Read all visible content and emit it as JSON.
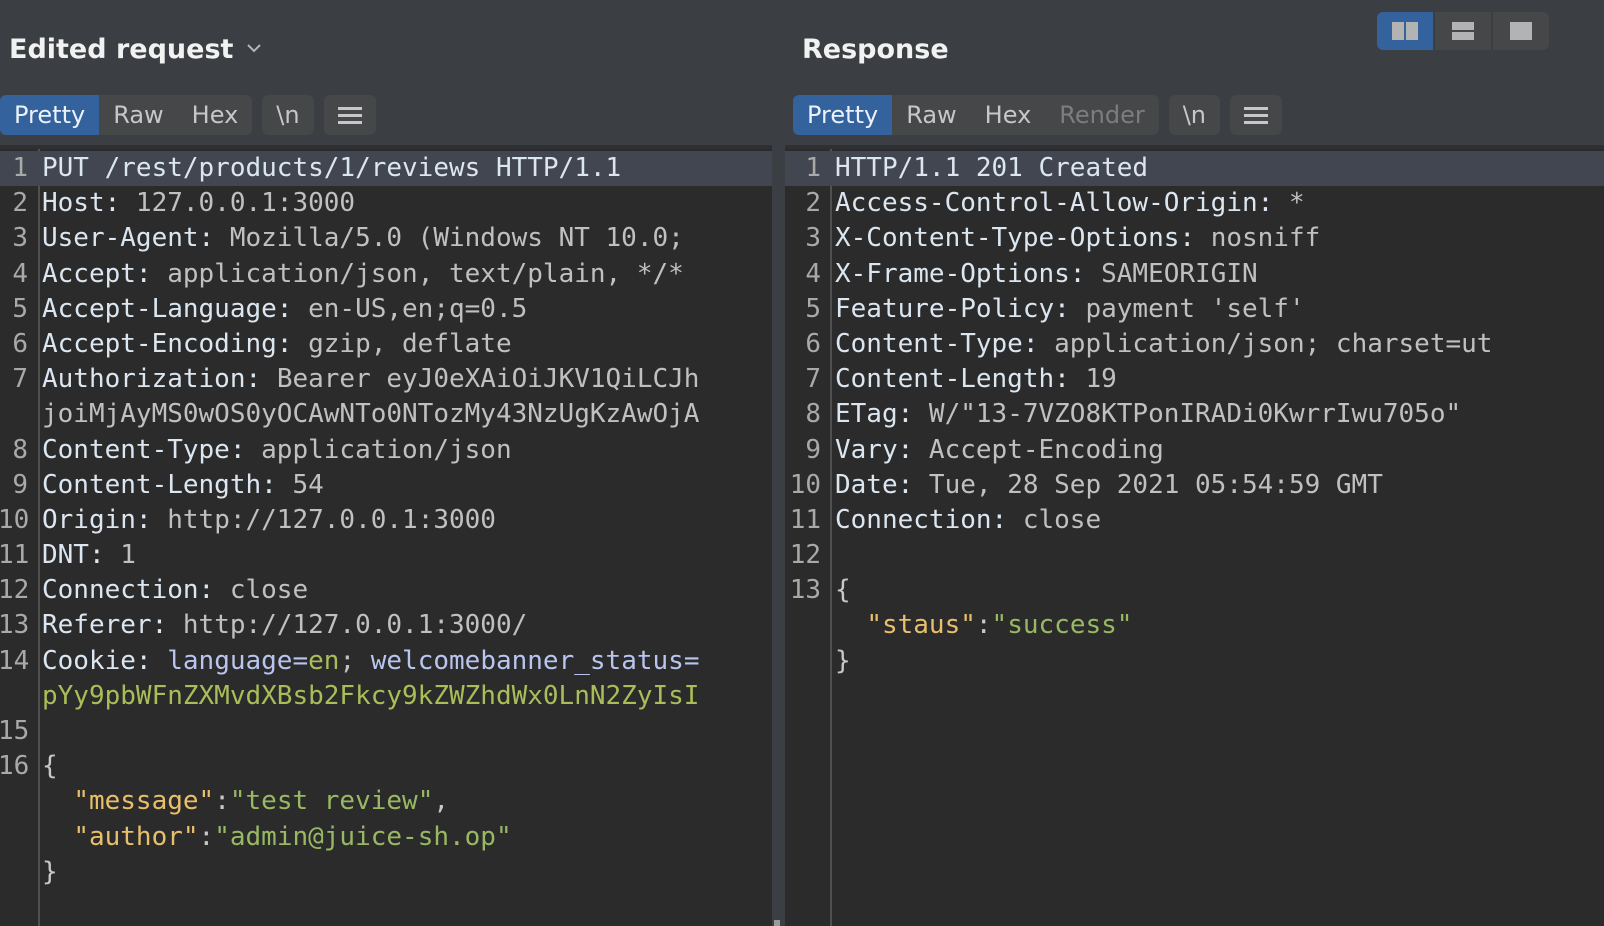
{
  "request": {
    "title": "Edited request",
    "tabs": [
      {
        "label": "Pretty",
        "active": true
      },
      {
        "label": "Raw",
        "active": false
      },
      {
        "label": "Hex",
        "active": false
      }
    ],
    "newline_toggle": "\\n",
    "menu_icon": "hamburger-menu-icon",
    "lines": {
      "l1": {
        "num": "1",
        "text": "PUT /rest/products/1/reviews HTTP/1.1"
      },
      "l2": {
        "num": "2",
        "name": "Host: ",
        "value": "127.0.0.1:3000"
      },
      "l3": {
        "num": "3",
        "name": "User-Agent: ",
        "value": "Mozilla/5.0 (Windows NT 10.0; "
      },
      "l4": {
        "num": "4",
        "name": "Accept: ",
        "value": "application/json, text/plain, */*"
      },
      "l5": {
        "num": "5",
        "name": "Accept-Language: ",
        "value": "en-US,en;q=0.5"
      },
      "l6": {
        "num": "6",
        "name": "Accept-Encoding: ",
        "value": "gzip, deflate"
      },
      "l7": {
        "num": "7",
        "name": "Authorization: ",
        "value": "Bearer eyJ0eXAiOiJKV1QiLCJh",
        "cont": "joiMjAyMS0wOS0yOCAwNTo0NTozMy43NzUgKzAwOjA"
      },
      "l8": {
        "num": "8",
        "name": "Content-Type: ",
        "value": "application/json"
      },
      "l9": {
        "num": "9",
        "name": "Content-Length: ",
        "value": "54"
      },
      "l10": {
        "num": "10",
        "name": "Origin: ",
        "value": "http://127.0.0.1:3000"
      },
      "l11": {
        "num": "11",
        "name": "DNT: ",
        "value": "1"
      },
      "l12": {
        "num": "12",
        "name": "Connection: ",
        "value": "close"
      },
      "l13": {
        "num": "13",
        "name": "Referer: ",
        "value": "http://127.0.0.1:3000/"
      },
      "l14": {
        "num": "14",
        "name": "Cookie: ",
        "ck1_name": "language",
        "eq": "=",
        "ck1_val": "en",
        "sep": "; ",
        "ck2_name": "welcomebanner_status=",
        "cont": "pYy9pbWFnZXMvdXBsb2Fkcy9kZWZhdWx0LnN2ZyIsI"
      },
      "l15": {
        "num": "15"
      },
      "l16": {
        "num": "16",
        "open": "{"
      },
      "body": {
        "k1": "\"message\"",
        "v1": "\"test review\"",
        "k2": "\"author\"",
        "v2": "\"admin@juice-sh.op\"",
        "colon": ":",
        "comma": ",",
        "close": "}"
      }
    }
  },
  "response": {
    "title": "Response",
    "tabs": [
      {
        "label": "Pretty",
        "active": true
      },
      {
        "label": "Raw",
        "active": false
      },
      {
        "label": "Hex",
        "active": false
      },
      {
        "label": "Render",
        "active": false,
        "disabled": true
      }
    ],
    "newline_toggle": "\\n",
    "menu_icon": "hamburger-menu-icon",
    "lines": {
      "l1": {
        "num": "1",
        "text": "HTTP/1.1 201 Created"
      },
      "l2": {
        "num": "2",
        "name": "Access-Control-Allow-Origin: ",
        "value": "*"
      },
      "l3": {
        "num": "3",
        "name": "X-Content-Type-Options: ",
        "value": "nosniff"
      },
      "l4": {
        "num": "4",
        "name": "X-Frame-Options: ",
        "value": "SAMEORIGIN"
      },
      "l5": {
        "num": "5",
        "name": "Feature-Policy: ",
        "value": "payment 'self'"
      },
      "l6": {
        "num": "6",
        "name": "Content-Type: ",
        "value": "application/json; charset=ut"
      },
      "l7": {
        "num": "7",
        "name": "Content-Length: ",
        "value": "19"
      },
      "l8": {
        "num": "8",
        "name": "ETag: ",
        "value": "W/\"13-7VZO8KTPonIRADi0KwrrIwu705o\""
      },
      "l9": {
        "num": "9",
        "name": "Vary: ",
        "value": "Accept-Encoding"
      },
      "l10": {
        "num": "10",
        "name": "Date: ",
        "value": "Tue, 28 Sep 2021 05:54:59 GMT"
      },
      "l11": {
        "num": "11",
        "name": "Connection: ",
        "value": "close"
      },
      "l12": {
        "num": "12"
      },
      "l13": {
        "num": "13",
        "open": "{"
      },
      "body": {
        "k1": "\"staus\"",
        "v1": "\"success\"",
        "colon": ":",
        "close": "}"
      }
    }
  },
  "layout_toggle": {
    "options": [
      "side-by-side",
      "stacked",
      "single"
    ],
    "active": "side-by-side"
  },
  "colors": {
    "accent": "#34629c",
    "background": "#3b3e42",
    "editor_bg": "#2b2b2b",
    "json_key": "#e8bf6a",
    "json_string": "#98b863",
    "cookie_name": "#b9c4ef",
    "cookie_value": "#a9bd58"
  }
}
